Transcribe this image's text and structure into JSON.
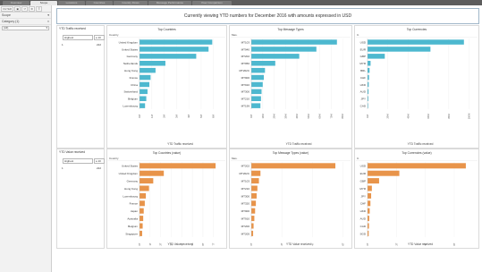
{
  "tabs": [
    {
      "label": "Overview"
    },
    {
      "label": "Scope"
    },
    {
      "label": "Locations"
    },
    {
      "label": "Countries"
    },
    {
      "label": "Country Flows"
    },
    {
      "label": "Message Performance"
    },
    {
      "label": "Peer Comparison"
    }
  ],
  "sidebar": {
    "filter_label": "FILTER",
    "scope_label": "Scope",
    "category_label": "Category (1)",
    "category_value": "(All)"
  },
  "banner": "Currently viewing YTD numbers for December 2016 with amounts expressed in USD",
  "traffic_section": {
    "title": "YTD Traffic received",
    "rank_select": "Highest",
    "rank_count": "≤ 10",
    "legend_value": "1",
    "legend_extra": "222"
  },
  "value_section": {
    "title": "YTD Value received",
    "rank_select": "Highest",
    "rank_count": "≤ 10",
    "legend_value": "1",
    "legend_extra": "222"
  },
  "colors": {
    "teal": "#4db8cf",
    "orange": "#e8944a"
  },
  "chart_data": [
    {
      "type": "bar",
      "orientation": "horizontal",
      "title": "Top Countries",
      "category_header": "Country",
      "xlabel": "YTD Traffic received",
      "categories": [
        "United Kingdom",
        "United States",
        "Germany",
        "Netherlands",
        "Hong Kong",
        "France",
        "China",
        "Switzerland",
        "Belgium",
        "Luxembourg"
      ],
      "values": [
        5.9,
        5.6,
        4.6,
        2.1,
        1.3,
        0.9,
        0.8,
        0.65,
        0.55,
        0.45
      ],
      "ticks": [
        "0M",
        "1M",
        "2M",
        "3M",
        "4M",
        "5M",
        "6M"
      ],
      "xlim": [
        0,
        6.6
      ],
      "color": "#4db8cf"
    },
    {
      "type": "bar",
      "orientation": "horizontal",
      "title": "Top Message Types",
      "category_header": "Mes.",
      "xlabel": "YTD Traffic received",
      "categories": [
        "MT103",
        "MT940",
        "MT202",
        "MT950",
        "MT202C",
        "MT900",
        "MT910",
        "MT300",
        "MT210",
        "MT199"
      ],
      "values": [
        75,
        57,
        42,
        21,
        12,
        11,
        10,
        9,
        8.5,
        8
      ],
      "ticks": [
        "0M",
        "10M",
        "20M",
        "30M",
        "40M",
        "50M",
        "60M",
        "70M",
        "80M"
      ],
      "xlim": [
        0,
        83
      ],
      "color": "#4db8cf"
    },
    {
      "type": "bar",
      "orientation": "horizontal",
      "title": "Top Currencies",
      "category_header": "C.",
      "xlabel": "YTD Traffic received",
      "categories": [
        "USD",
        "EUR",
        "GBP",
        "MYR",
        "BRL",
        "CHF",
        "HKD",
        "AUD",
        "JPY",
        "CAD"
      ],
      "values": [
        95,
        62,
        17,
        3,
        2,
        1.5,
        1.2,
        1,
        0.8,
        0.6
      ],
      "ticks": [
        "0M",
        "20M",
        "40M",
        "60M",
        "80M",
        "100M"
      ],
      "xlim": [
        0,
        104
      ],
      "color": "#4db8cf"
    },
    {
      "type": "bar",
      "orientation": "horizontal",
      "title": "Top Countries (value)",
      "category_header": "Country",
      "xlabel": "YTD Value received",
      "categories": [
        "United States",
        "United Kingdom",
        "Germany",
        "Hong Kong",
        "Luxembourg",
        "France",
        "Japan",
        "Australia",
        "Belgium",
        "Singapore"
      ],
      "values": [
        7.2,
        2.3,
        1.3,
        0.9,
        0.6,
        0.5,
        0.4,
        0.35,
        0.3,
        0.25
      ],
      "ticks": [
        "0T",
        "1T",
        "2T",
        "3T",
        "4T",
        "5T",
        "6T",
        "7T"
      ],
      "xlim": [
        0,
        7.7
      ],
      "color": "#e8944a"
    },
    {
      "type": "bar",
      "orientation": "horizontal",
      "title": "Top Message Types (value)",
      "category_header": "Mes.",
      "xlabel": "YTD Value received",
      "categories": [
        "MT202",
        "MT202C",
        "MT103",
        "MT210",
        "MT300",
        "MT320",
        "MT900",
        "MT910",
        "MT200",
        "MT205"
      ],
      "values": [
        5.5,
        0.6,
        0.5,
        0.4,
        0.35,
        0.3,
        0.25,
        0.2,
        0.15,
        0.12
      ],
      "ticks": [
        "0T",
        "2T",
        "4T",
        "6T"
      ],
      "xlim": [
        0,
        6.2
      ],
      "color": "#e8944a"
    },
    {
      "type": "bar",
      "orientation": "horizontal",
      "title": "Top Currencies (value)",
      "category_header": "C.",
      "xlabel": "YTD Value received",
      "categories": [
        "USD",
        "EUR",
        "GBP",
        "MYR",
        "JPY",
        "CHF",
        "HKD",
        "AUD",
        "CAD",
        "SGD"
      ],
      "values": [
        6.8,
        2.2,
        0.8,
        0.3,
        0.25,
        0.2,
        0.15,
        0.12,
        0.1,
        0.08
      ],
      "ticks": [
        "0T",
        "2T",
        "4T",
        "6T"
      ],
      "xlim": [
        0,
        7.3
      ],
      "color": "#e8944a"
    }
  ]
}
